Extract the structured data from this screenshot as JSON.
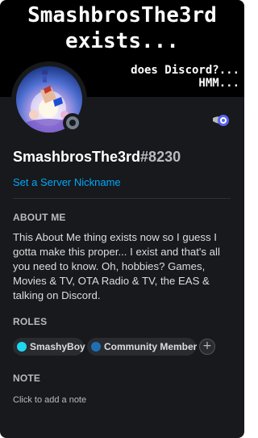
{
  "banner": {
    "line1": "SmashbrosThe3rd",
    "line2": "exists...",
    "line3": "does Discord?...",
    "line4": "HMM..."
  },
  "profile": {
    "username": "SmashbrosThe3rd",
    "discriminator": "#8230",
    "set_nickname_label": "Set a Server Nickname",
    "status": "offline",
    "badge_icon": "hypesquad-badge-icon"
  },
  "about_me": {
    "title": "ABOUT ME",
    "text": "This About Me thing exists now so I guess I gotta make this proper... I exist and that's all you need to know. Oh, hobbies? Games, Movies & TV, OTA Radio & TV, the EAS & talking on Discord."
  },
  "roles": {
    "title": "ROLES",
    "items": [
      {
        "label": "SmashyBoy",
        "color": "#1fd6f0"
      },
      {
        "label": "Community Member",
        "color": "#1f6fb5"
      }
    ],
    "add_label": "+"
  },
  "note": {
    "title": "NOTE",
    "placeholder": "Click to add a note"
  },
  "colors": {
    "card_bg": "#18191c",
    "link": "#00a8fc",
    "muted": "#b9bbbe"
  }
}
